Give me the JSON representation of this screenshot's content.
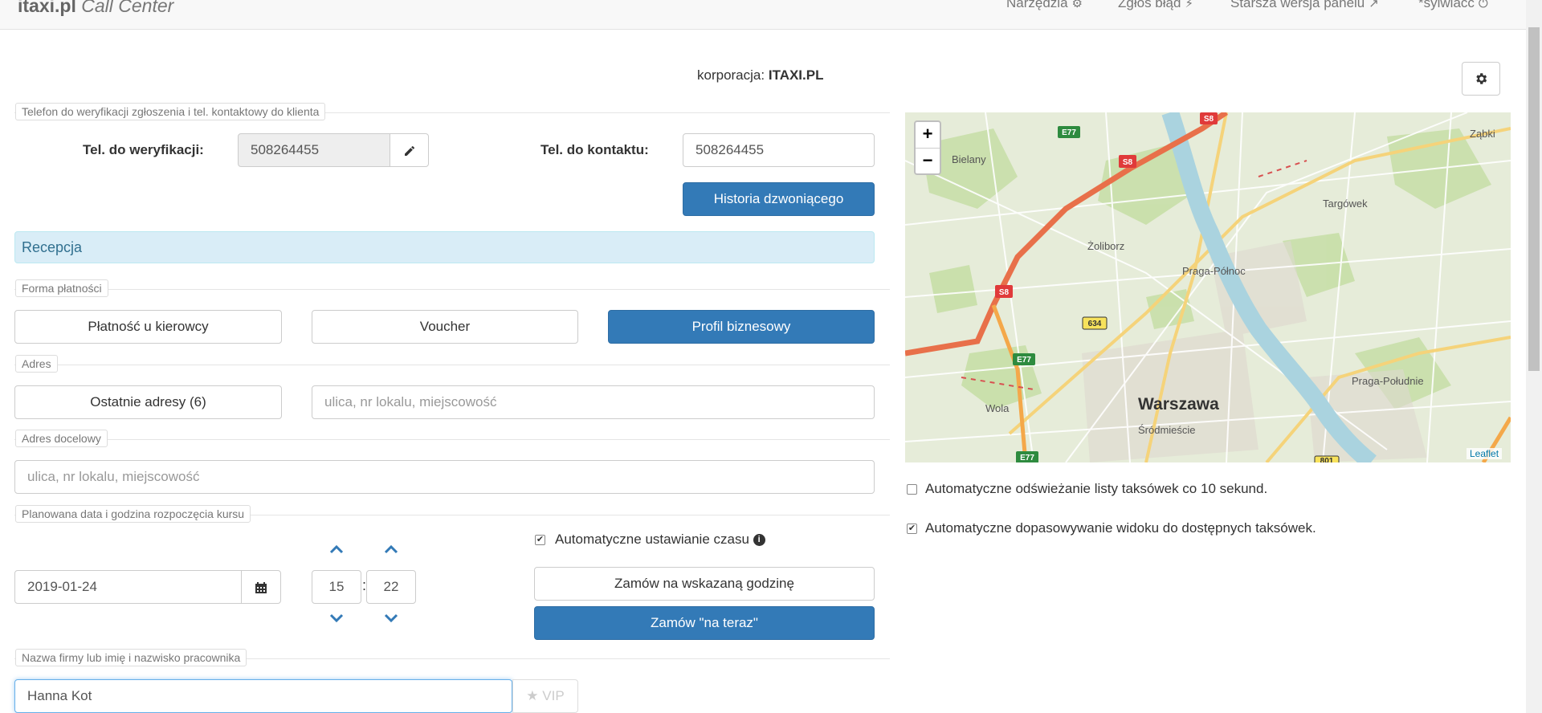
{
  "navbar": {
    "brand_bold": "itaxi.pl",
    "brand_italic": "Call Center",
    "links": [
      "Narzędzia",
      "Zgłoś błąd",
      "Starsza wersja panelu",
      "*sylwiacc"
    ]
  },
  "corporation": {
    "label": "korporacja:",
    "value": "ITAXI.PL"
  },
  "phone_section": {
    "legend": "Telefon do weryfikacji zgłoszenia i tel. kontaktowy do klienta",
    "verify_label": "Tel. do weryfikacji:",
    "verify_value": "508264455",
    "contact_label": "Tel. do kontaktu:",
    "contact_value": "508264455",
    "history_button": "Historia dzwoniącego"
  },
  "reception_alert": "Recepcja",
  "payment": {
    "legend": "Forma płatności",
    "options": [
      "Płatność u kierowcy",
      "Voucher",
      "Profil biznesowy"
    ],
    "selected": "Profil biznesowy"
  },
  "address": {
    "legend": "Adres",
    "recent_button": "Ostatnie adresy (6)",
    "placeholder": "ulica, nr lokalu, miejscowość"
  },
  "destination": {
    "legend": "Adres docelowy",
    "placeholder": "ulica, nr lokalu, miejscowość"
  },
  "schedule": {
    "legend": "Planowana data i godzina rozpoczęcia kursu",
    "date": "2019-01-24",
    "hour": "15",
    "minute": "22",
    "separator": ":",
    "auto_time_label": "Automatyczne ustawianie czasu",
    "auto_time_checked": true,
    "order_at_time_button": "Zamów na wskazaną godzinę",
    "order_now_button": "Zamów \"na teraz\""
  },
  "company": {
    "legend": "Nazwa firmy lub imię i nazwisko pracownika",
    "value": "Hanna Kot",
    "vip_button": "VIP"
  },
  "map": {
    "labels": [
      "Ząbki",
      "Bielany",
      "Targówek",
      "Żoliborz",
      "Praga-Północ",
      "Praga-Południe",
      "Warszawa",
      "Wola",
      "Śródmieście"
    ],
    "road_badges": [
      "E77",
      "S8",
      "S8",
      "S8",
      "634",
      "E77",
      "E77",
      "801"
    ],
    "zoom_in": "+",
    "zoom_out": "−",
    "attribution": "Leaflet"
  },
  "options": {
    "auto_refresh_label": "Automatyczne odświeżanie listy taksówek co 10 sekund.",
    "auto_refresh_checked": false,
    "auto_fit_label": "Automatyczne dopasowywanie widoku do dostępnych taksówek.",
    "auto_fit_checked": true
  },
  "colors": {
    "primary": "#337ab7",
    "alert_bg": "#d9edf7",
    "alert_text": "#31708f",
    "map_land": "#e6ecd9",
    "map_water": "#aad3df",
    "map_highway": "#e8704a"
  }
}
